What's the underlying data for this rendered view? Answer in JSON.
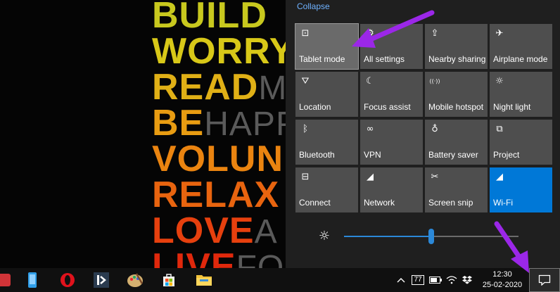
{
  "wallpaper": {
    "words": [
      {
        "text": "BUILD",
        "rest": "",
        "color": "#c8c81e"
      },
      {
        "text": "WORRY",
        "rest": "",
        "color": "#d8c818"
      },
      {
        "text": "READ",
        "rest": "M",
        "color": "#e0b016"
      },
      {
        "text": "BE",
        "rest": "HAPP",
        "color": "#e89c12"
      },
      {
        "text": "VOLUN",
        "rest": "",
        "color": "#ea8410"
      },
      {
        "text": "RELAX",
        "rest": "",
        "color": "#e8640f"
      },
      {
        "text": "LOVE",
        "rest": "A",
        "color": "#e6400e"
      },
      {
        "text": "LIVE",
        "rest": "FO",
        "color": "#e0280c"
      }
    ]
  },
  "action_center": {
    "collapse_label": "Collapse",
    "tiles": [
      {
        "label": "Tablet mode",
        "icon": "tablet-mode-icon",
        "glyph": "⊡",
        "state": "hover"
      },
      {
        "label": "All settings",
        "icon": "settings-icon",
        "glyph": "⚙",
        "state": "normal"
      },
      {
        "label": "Nearby sharing",
        "icon": "nearby-sharing-icon",
        "glyph": "⇪",
        "state": "normal"
      },
      {
        "label": "Airplane mode",
        "icon": "airplane-icon",
        "glyph": "✈",
        "state": "normal"
      },
      {
        "label": "Location",
        "icon": "location-icon",
        "glyph": "⛛",
        "state": "normal"
      },
      {
        "label": "Focus assist",
        "icon": "moon-icon",
        "glyph": "☾",
        "state": "normal"
      },
      {
        "label": "Mobile hotspot",
        "icon": "hotspot-icon",
        "glyph": "((·))",
        "state": "normal"
      },
      {
        "label": "Night light",
        "icon": "night-light-icon",
        "glyph": "☼",
        "state": "normal"
      },
      {
        "label": "Bluetooth",
        "icon": "bluetooth-icon",
        "glyph": "ᛒ",
        "state": "normal"
      },
      {
        "label": "VPN",
        "icon": "vpn-icon",
        "glyph": "∞",
        "state": "normal"
      },
      {
        "label": "Battery saver",
        "icon": "battery-saver-icon",
        "glyph": "♁",
        "state": "normal"
      },
      {
        "label": "Project",
        "icon": "project-icon",
        "glyph": "⧉",
        "state": "normal"
      },
      {
        "label": "Connect",
        "icon": "connect-icon",
        "glyph": "⊟",
        "state": "normal"
      },
      {
        "label": "Network",
        "icon": "network-icon",
        "glyph": "◢",
        "state": "normal"
      },
      {
        "label": "Screen snip",
        "icon": "screen-snip-icon",
        "glyph": "✂",
        "state": "normal"
      },
      {
        "label": "Wi-Fi",
        "icon": "wifi-icon",
        "glyph": "◢",
        "state": "active"
      }
    ],
    "brightness": {
      "icon": "brightness-icon",
      "level": 0.5
    }
  },
  "taskbar": {
    "apps": [
      {
        "name": "taskbar-app-partial",
        "icon": "app-icon",
        "color": "#d13438"
      },
      {
        "name": "taskbar-app-phone",
        "icon": "phone-icon",
        "color": "#2f9ee8"
      },
      {
        "name": "taskbar-app-opera",
        "icon": "opera-icon",
        "color": "#e0121c"
      },
      {
        "name": "taskbar-app-editor",
        "icon": "editor-icon",
        "color": "#2a3b4f"
      },
      {
        "name": "taskbar-app-paint",
        "icon": "paint-icon",
        "color": "#d4b070"
      },
      {
        "name": "taskbar-app-store",
        "icon": "store-icon",
        "color": "#ffffff"
      },
      {
        "name": "taskbar-app-explorer",
        "icon": "folder-icon",
        "color": "#f2c23a"
      }
    ],
    "tray": {
      "badge": "77",
      "time": "12:30",
      "date": "25-02-2020"
    }
  },
  "colors": {
    "accent": "#0078d7",
    "arrow": "#9b27e8"
  }
}
